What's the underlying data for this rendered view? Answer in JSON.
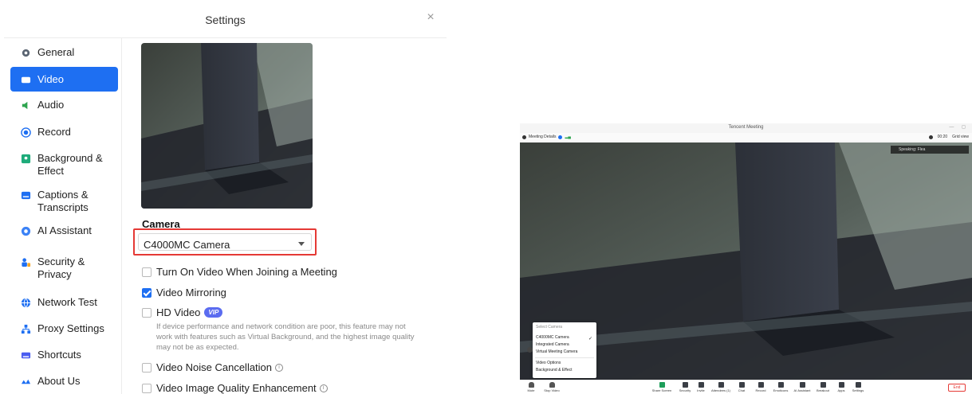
{
  "settings": {
    "title": "Settings",
    "close_glyph": "×",
    "nav": [
      {
        "label": "General",
        "icon": "gear-icon"
      },
      {
        "label": "Video",
        "icon": "video-camera-icon"
      },
      {
        "label": "Audio",
        "icon": "speaker-icon"
      },
      {
        "label": "Record",
        "icon": "record-icon"
      },
      {
        "label": "Background & Effect",
        "icon": "background-icon"
      },
      {
        "label": "Captions & Transcripts",
        "icon": "captions-icon"
      },
      {
        "label": "AI Assistant",
        "icon": "ai-assistant-icon"
      },
      {
        "label": "Security & Privacy",
        "icon": "security-icon"
      },
      {
        "label": "Network Test",
        "icon": "globe-icon"
      },
      {
        "label": "Proxy Settings",
        "icon": "proxy-icon"
      },
      {
        "label": "Shortcuts",
        "icon": "keyboard-icon"
      },
      {
        "label": "About Us",
        "icon": "about-icon"
      }
    ],
    "active_nav": "Video",
    "camera": {
      "section_title": "Camera",
      "selected": "C4000MC  Camera"
    },
    "options": {
      "turn_on_video": {
        "label": "Turn On Video When Joining a Meeting",
        "checked": false
      },
      "video_mirroring": {
        "label": "Video Mirroring",
        "checked": true
      },
      "hd_video": {
        "label": "HD Video",
        "badge": "VIP",
        "checked": false
      },
      "hd_hint": "If device performance and network condition are poor, this feature may not work with features such as Virtual Background, and the highest image quality may not be as expected.",
      "noise_cancellation": {
        "label": "Video Noise Cancellation",
        "checked": false
      },
      "quality_enhancement": {
        "label": "Video Image Quality Enhancement",
        "checked": false
      }
    },
    "colors": {
      "accent": "#1e6ff2",
      "highlight": "#e53935"
    }
  },
  "meeting": {
    "title": "Tencent Meeting",
    "window_controls": "— ◻",
    "meeting_details": "Meeting Details",
    "timer": "00:20",
    "grid_view": "Grid view",
    "speaking": "Speaking:  Flea",
    "camera_menu": {
      "header": "Select Camera",
      "items": [
        "C4000MC  Camera",
        "Integrated Camera",
        "Virtual Meeting Camera"
      ],
      "selected_check": "✓",
      "extra": [
        "Video Options",
        "Background & Effect"
      ]
    },
    "toolbar": {
      "mute": "Mute",
      "stop_video": "Stop Video",
      "items": [
        "Share Screen",
        "Security",
        "Invite",
        "Attendees (1)",
        "Chat",
        "Record",
        "Emoticons",
        "AI Assistant",
        "Breakout",
        "Apps",
        "Settings"
      ],
      "end": "End"
    }
  }
}
